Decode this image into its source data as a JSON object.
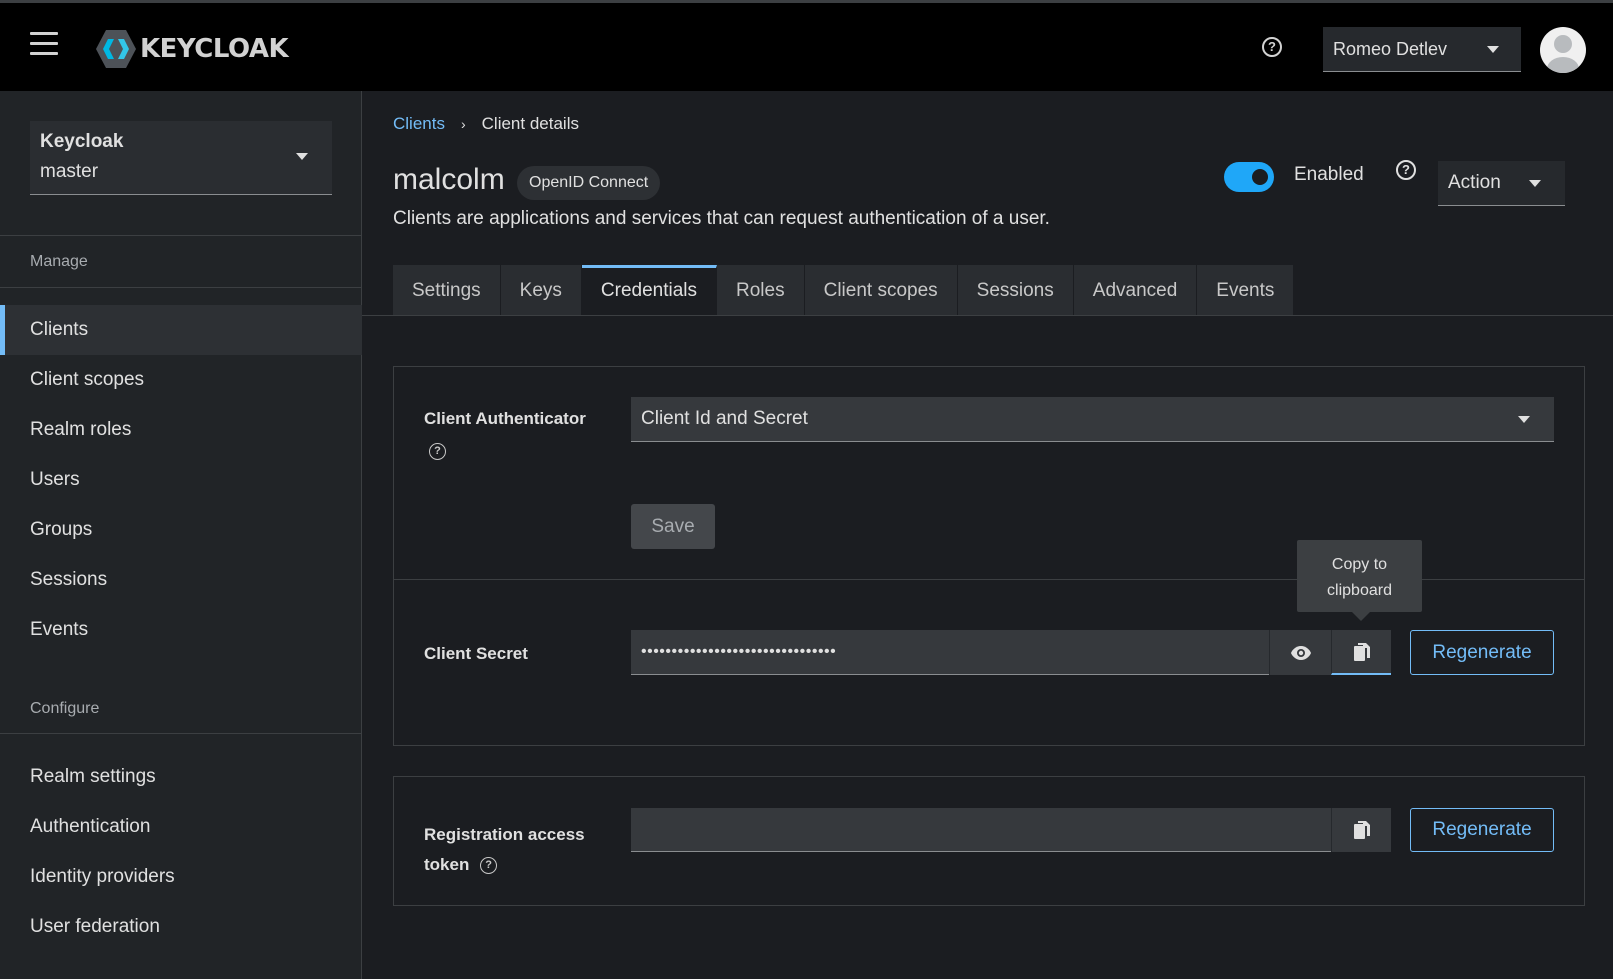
{
  "header": {
    "logo_text": "KEYCLOAK",
    "help_label": "?",
    "user_name": "Romeo Detlev"
  },
  "sidebar": {
    "realm": {
      "name": "Keycloak",
      "sub": "master"
    },
    "manage_label": "Manage",
    "manage_items": [
      {
        "label": "Clients",
        "active": true
      },
      {
        "label": "Client scopes"
      },
      {
        "label": "Realm roles"
      },
      {
        "label": "Users"
      },
      {
        "label": "Groups"
      },
      {
        "label": "Sessions"
      },
      {
        "label": "Events"
      }
    ],
    "configure_label": "Configure",
    "configure_items": [
      {
        "label": "Realm settings"
      },
      {
        "label": "Authentication"
      },
      {
        "label": "Identity providers"
      },
      {
        "label": "User federation"
      }
    ]
  },
  "breadcrumb": {
    "parent": "Clients",
    "separator": "›",
    "current": "Client details"
  },
  "page": {
    "title": "malcolm",
    "protocol": "OpenID Connect",
    "description": "Clients are applications and services that can request authentication of a user.",
    "enabled_label": "Enabled",
    "enabled": true,
    "help_label": "?",
    "action_label": "Action"
  },
  "tabs": [
    {
      "label": "Settings"
    },
    {
      "label": "Keys"
    },
    {
      "label": "Credentials",
      "active": true
    },
    {
      "label": "Roles"
    },
    {
      "label": "Client scopes"
    },
    {
      "label": "Sessions"
    },
    {
      "label": "Advanced"
    },
    {
      "label": "Events"
    }
  ],
  "credentials": {
    "authenticator_label": "Client Authenticator",
    "authenticator_value": "Client Id and Secret",
    "save_label": "Save",
    "secret_label": "Client Secret",
    "secret_value": "••••••••••••••••••••••••••••••••",
    "regenerate_label": "Regenerate",
    "tooltip_text": "Copy to clipboard",
    "registration_label_1": "Registration access",
    "registration_label_2": "token",
    "registration_value": "",
    "help_label": "?"
  },
  "colors": {
    "accent": "#73bcf7",
    "toggle_on": "#1fa7f8",
    "masthead": "#000000",
    "background": "#1b1d21"
  }
}
